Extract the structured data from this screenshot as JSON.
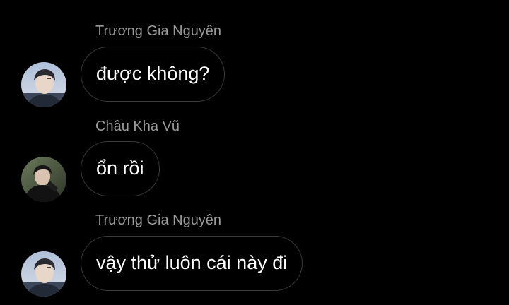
{
  "messages": [
    {
      "sender": "Trương Gia Nguyên",
      "text": "được không?",
      "avatar_icon": "avatar-photo-light"
    },
    {
      "sender": "Châu Kha Vũ",
      "text": "ổn rồi",
      "avatar_icon": "avatar-photo-dark"
    },
    {
      "sender": "Trương Gia Nguyên",
      "text": "vậy thử luôn cái này đi",
      "avatar_icon": "avatar-photo-light"
    }
  ],
  "colors": {
    "background": "#000000",
    "sender_name": "#9a9a9a",
    "bubble_border": "#3a3a3a",
    "message_text": "#ffffff"
  }
}
